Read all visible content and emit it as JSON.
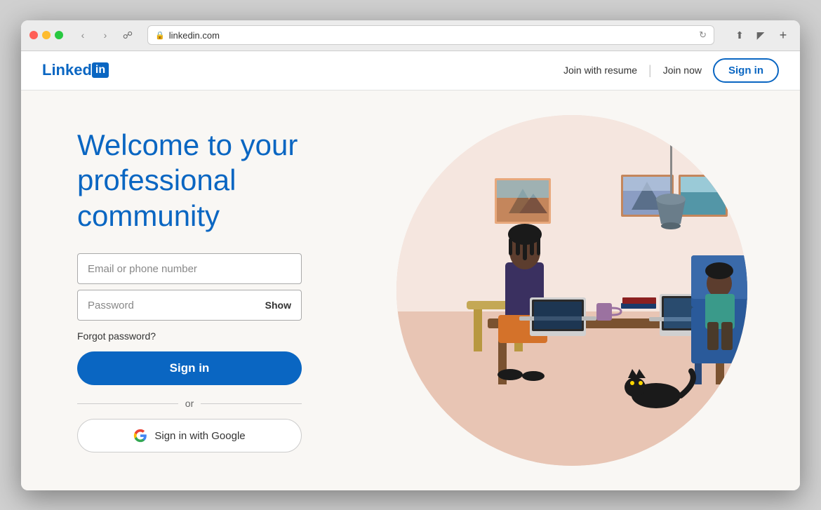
{
  "browser": {
    "url": "linkedin.com",
    "back_btn": "‹",
    "forward_btn": "›",
    "refresh_btn": "↻",
    "new_tab_btn": "+"
  },
  "header": {
    "logo_linked": "Linked",
    "logo_in": "in",
    "nav_join_resume": "Join with resume",
    "nav_join_now": "Join now",
    "nav_sign_in": "Sign in"
  },
  "main": {
    "welcome_line1": "Welcome to your",
    "welcome_line2": "professional community",
    "email_placeholder": "Email or phone number",
    "password_placeholder": "Password",
    "show_label": "Show",
    "forgot_label": "Forgot password?",
    "sign_in_btn": "Sign in",
    "or_text": "or",
    "google_btn": "Sign in with Google"
  },
  "colors": {
    "linkedin_blue": "#0a66c2",
    "bg": "#f9f7f4",
    "illustration_bg": "#f0ddd5"
  }
}
